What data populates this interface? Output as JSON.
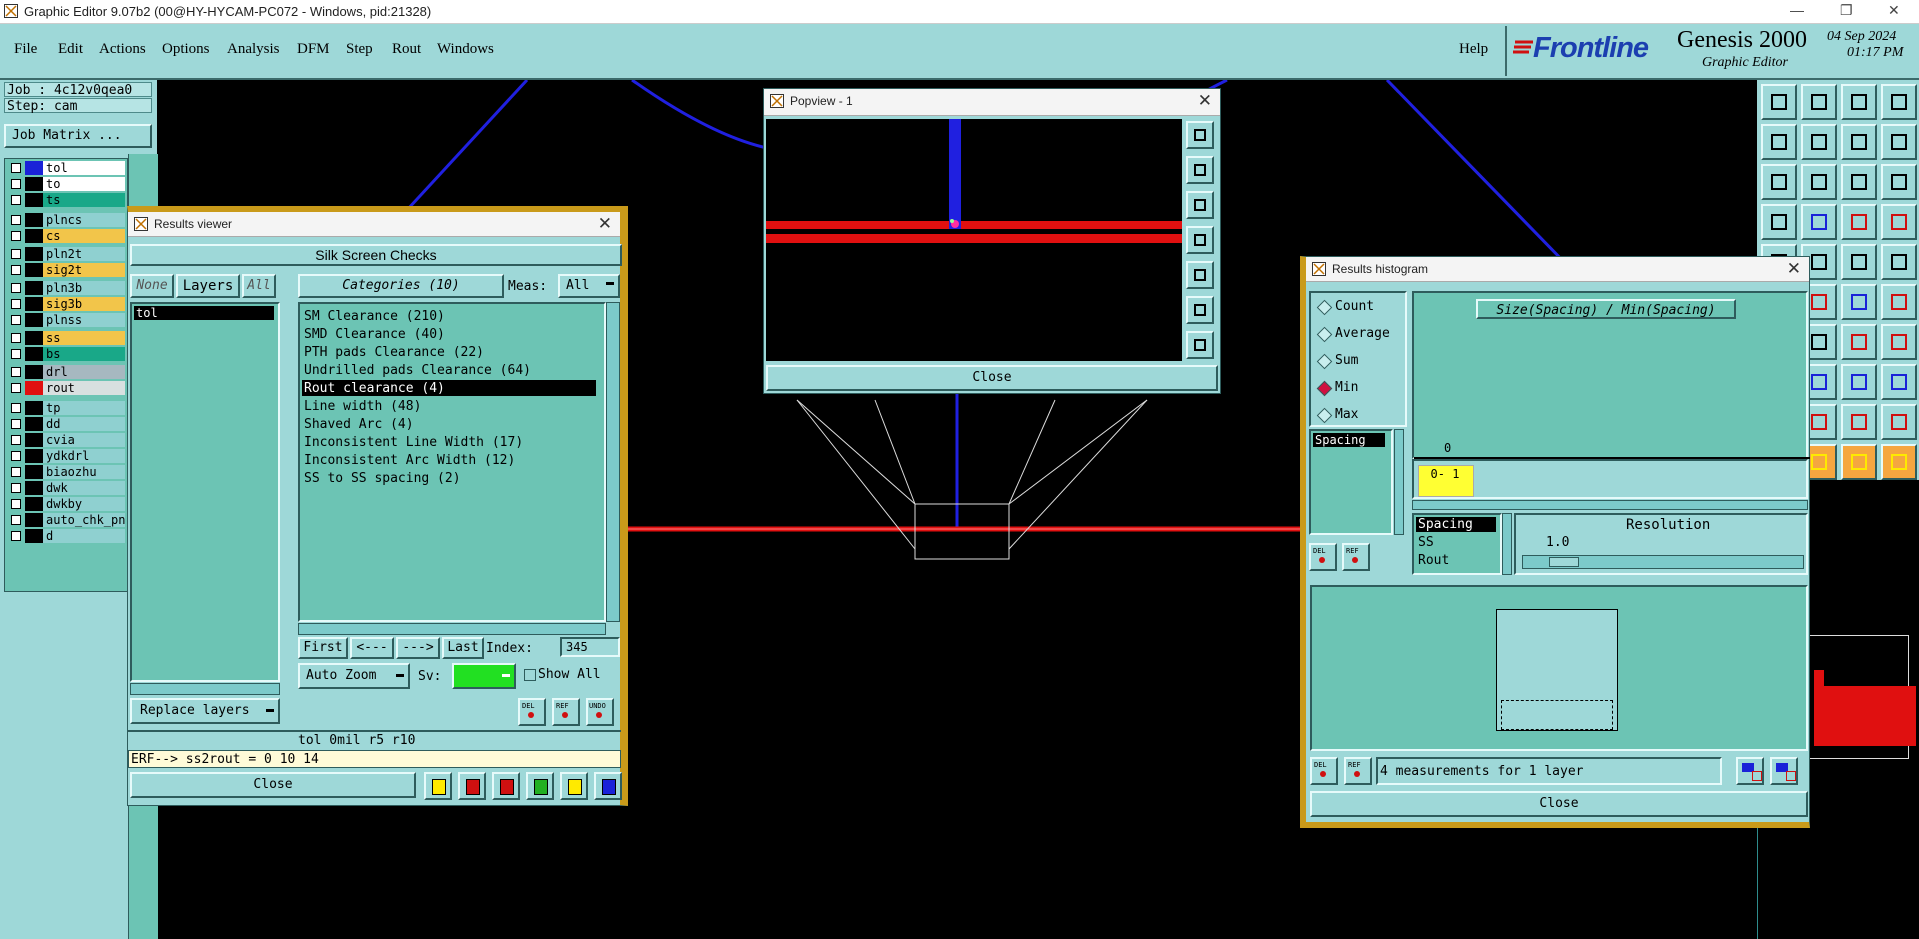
{
  "os": {
    "title": "Graphic Editor 9.07b2 (00@HY-HYCAM-PC072 - Windows, pid:21328)"
  },
  "menu": {
    "items": [
      "File",
      "Edit",
      "Actions",
      "Options",
      "Analysis",
      "DFM",
      "Step",
      "Rout",
      "Windows"
    ],
    "help": "Help"
  },
  "brand": {
    "logo": "Frontline",
    "product": "Genesis 2000",
    "subtitle": "Graphic Editor",
    "date": "04 Sep 2024",
    "time": "01:17 PM"
  },
  "left": {
    "job": "Job : 4c12v0qea0",
    "step": "Step: cam",
    "job_matrix": "Job Matrix ...",
    "layers": [
      {
        "name": "tol",
        "swatch": "#1a22d8",
        "bg": "#ffffff"
      },
      {
        "name": "to",
        "swatch": "#000000",
        "bg": "#ffffff"
      },
      {
        "name": "ts",
        "swatch": "#000000",
        "bg": "#19a888"
      },
      {
        "name": "plncs",
        "swatch": "#000000",
        "bg": "#8fd0d0"
      },
      {
        "name": "cs",
        "swatch": "#000000",
        "bg": "#f2c54a"
      },
      {
        "name": "pln2t",
        "swatch": "#000000",
        "bg": "#8fd0d0"
      },
      {
        "name": "sig2t",
        "swatch": "#000000",
        "bg": "#f2c54a"
      },
      {
        "name": "pln3b",
        "swatch": "#000000",
        "bg": "#8fd0d0"
      },
      {
        "name": "sig3b",
        "swatch": "#000000",
        "bg": "#f2c54a"
      },
      {
        "name": "plnss",
        "swatch": "#000000",
        "bg": "#8fd0d0"
      },
      {
        "name": "ss",
        "swatch": "#000000",
        "bg": "#f2c54a"
      },
      {
        "name": "bs",
        "swatch": "#000000",
        "bg": "#19a888"
      },
      {
        "name": "drl",
        "swatch": "#000000",
        "bg": "#a6b8c0"
      },
      {
        "name": "rout",
        "swatch": "#e01010",
        "bg": "#d8e0e0"
      },
      {
        "name": "tp",
        "swatch": "#000000",
        "bg": "#8fd0d0"
      },
      {
        "name": "dd",
        "swatch": "#000000",
        "bg": "#8fd0d0"
      },
      {
        "name": "cvia",
        "swatch": "#000000",
        "bg": "#8fd0d0"
      },
      {
        "name": "ydkdrl",
        "swatch": "#000000",
        "bg": "#8fd0d0"
      },
      {
        "name": "biaozhu",
        "swatch": "#000000",
        "bg": "#8fd0d0"
      },
      {
        "name": "dwk",
        "swatch": "#000000",
        "bg": "#8fd0d0"
      },
      {
        "name": "dwkby",
        "swatch": "#000000",
        "bg": "#8fd0d0"
      },
      {
        "name": "auto_chk_pn",
        "swatch": "#000000",
        "bg": "#8fd0d0"
      },
      {
        "name": "d",
        "swatch": "#000000",
        "bg": "#8fd0d0"
      }
    ]
  },
  "results_viewer": {
    "title": "Results viewer",
    "header": "Silk Screen Checks",
    "none_btn": "None",
    "layers_btn": "Layers",
    "all_btn": "All",
    "categories_btn": "Categories (10)",
    "meas_label": "Meas:",
    "meas_value": "All",
    "layer_items": [
      "tol"
    ],
    "categories": [
      "SM Clearance (210)",
      "SMD Clearance (40)",
      "PTH pads Clearance (22)",
      "Undrilled pads Clearance (64)",
      "Rout clearance (4)",
      "Line width (48)",
      "Shaved Arc (4)",
      "Inconsistent Line Width (17)",
      "Inconsistent Arc Width (12)",
      "SS to SS spacing (2)"
    ],
    "selected_category": 4,
    "first": "First",
    "prev": "<---",
    "next": "--->",
    "last": "Last",
    "index_label": "Index:",
    "index_value": "345",
    "auto_zoom": "Auto Zoom",
    "sv_label": "Sv:",
    "show_all": "Show All",
    "replace_layers": "Replace layers",
    "del": "DEL",
    "ref": "REF",
    "undo": "UNDO",
    "status": "tol 0mil  r5  r10",
    "erf": "ERF--> ss2rout = 0 10 14",
    "close": "Close"
  },
  "popview": {
    "title": "Popview - 1",
    "close": "Close"
  },
  "histogram": {
    "title": "Results histogram",
    "options": [
      "Count",
      "Average",
      "Sum",
      "Min",
      "Max"
    ],
    "selected_option": "Min",
    "chart_title": "Size(Spacing) / Min(Spacing)",
    "zero_label": "0",
    "bin_label": "0- 1",
    "measure_items": [
      "Spacing"
    ],
    "resolution_items": [
      "Spacing",
      "SS",
      "Rout"
    ],
    "resolution_label": "Resolution",
    "resolution_value": "1.0",
    "summary": "4 measurements for 1 layer",
    "del": "DEL",
    "ref": "REF",
    "close": "Close"
  },
  "colors": {
    "panel": "#9ed8d8",
    "list": "#6cc4b4",
    "canvas": "#000000",
    "selection_blue": "#1a22d8",
    "rout_red": "#e01010"
  }
}
